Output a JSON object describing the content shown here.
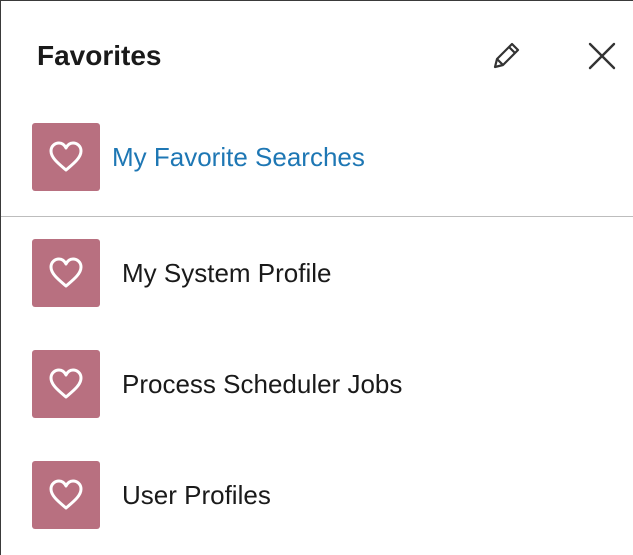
{
  "header": {
    "title": "Favorites",
    "edit_icon": "pencil-icon",
    "close_icon": "close-icon"
  },
  "searches": {
    "label": "My Favorite Searches",
    "icon": "heart-icon",
    "link_color": "#1e77b4"
  },
  "favorites": [
    {
      "label": "My System Profile",
      "icon": "heart-icon"
    },
    {
      "label": "Process Scheduler Jobs",
      "icon": "heart-icon"
    },
    {
      "label": "User Profiles",
      "icon": "heart-icon"
    }
  ],
  "colors": {
    "tile": "#b87080",
    "divider": "#bdbdbd",
    "text": "#1a1a1a"
  }
}
